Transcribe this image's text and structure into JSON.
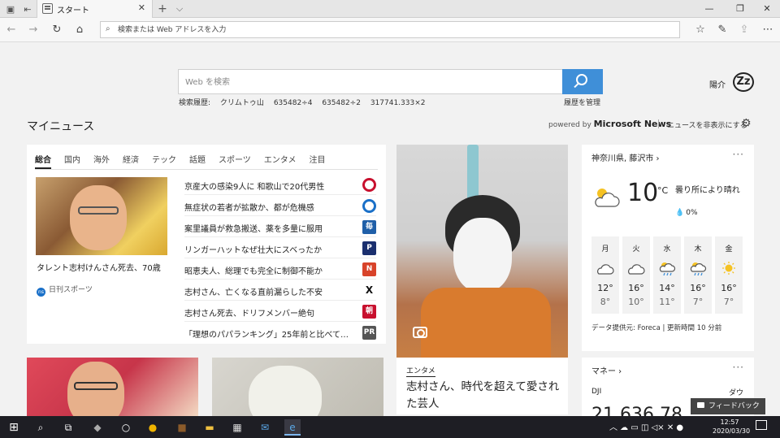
{
  "browser": {
    "tab_title": "スタート",
    "close_glyph": "✕",
    "new_tab_glyph": "+",
    "tab_list_glyph": "⌵",
    "address_placeholder": "検索または Web アドレスを入力"
  },
  "search": {
    "placeholder": "Web を検索",
    "history_label": "検索履歴:",
    "history_items": [
      "クリムトゥ山",
      "635482÷4",
      "635482÷2",
      "317741.333×2"
    ],
    "manage_history": "履歴を管理"
  },
  "weather_badge": "陽介",
  "news": {
    "section_title": "マイニュース",
    "powered_by_prefix": "powered by",
    "powered_by_brand": "Microsoft News",
    "hide_news": "ニュースを非表示にする",
    "tabs": [
      "総合",
      "国内",
      "海外",
      "経済",
      "テック",
      "話題",
      "スポーツ",
      "エンタメ",
      "注目"
    ],
    "hero": {
      "caption": "タレント志村けんさん死去、70歳",
      "source": "日刊スポーツ",
      "source_logo": "ns"
    },
    "headlines": [
      {
        "text": "京産大の感染9人に 和歌山で20代男性",
        "badge": "",
        "color": "#c8102e"
      },
      {
        "text": "無症状の若者が拡散か、都が危機感",
        "badge": "",
        "color": "#1a70c8"
      },
      {
        "text": "案里議員が救急搬送、薬を多量に服用",
        "badge": "毎",
        "color": "#1f5fa8"
      },
      {
        "text": "リンガーハットなぜ壮大にスベったか",
        "badge": "P",
        "color": "#1a2f6e"
      },
      {
        "text": "昭恵夫人、総理でも完全に制御不能か",
        "badge": "N",
        "color": "#d8432a"
      },
      {
        "text": "志村さん、亡くなる直前漏らした不安",
        "badge": "X",
        "color": "#ffffff"
      },
      {
        "text": "志村さん死去、ドリフメンバー絶句",
        "badge": "朝",
        "color": "#c8102e"
      },
      {
        "text": "「理想のパパランキング」25年前と比べて…",
        "badge": "PR",
        "color": "#555555"
      }
    ]
  },
  "photo_card": {
    "category": "エンタメ",
    "title": "志村さん、時代を超えて愛された芸人"
  },
  "weather": {
    "location": "神奈川県, 藤沢市",
    "temperature": "10",
    "unit": "°C",
    "condition": "曇り所により晴れ",
    "precip": "0%",
    "forecast": [
      {
        "day": "月",
        "high": "12°",
        "low": "8°",
        "icon": "cloud"
      },
      {
        "day": "火",
        "high": "16°",
        "low": "10°",
        "icon": "cloud"
      },
      {
        "day": "水",
        "high": "14°",
        "low": "11°",
        "icon": "sun-rain"
      },
      {
        "day": "木",
        "high": "16°",
        "low": "7°",
        "icon": "sun-rain"
      },
      {
        "day": "金",
        "high": "16°",
        "low": "7°",
        "icon": "sun"
      }
    ],
    "footer": "データ提供元: Foreca | 更新時間 10 分前"
  },
  "money": {
    "title": "マネー",
    "index": "DJI",
    "index_name": "ダウ",
    "value": "21,636.78"
  },
  "feedback": "フィードバック",
  "clock": {
    "time": "12:57",
    "date": "2020/03/30"
  },
  "colors": {
    "accent": "#3f8fd8",
    "background": "#f2f2f2",
    "taskbar": "#1e1e24"
  }
}
